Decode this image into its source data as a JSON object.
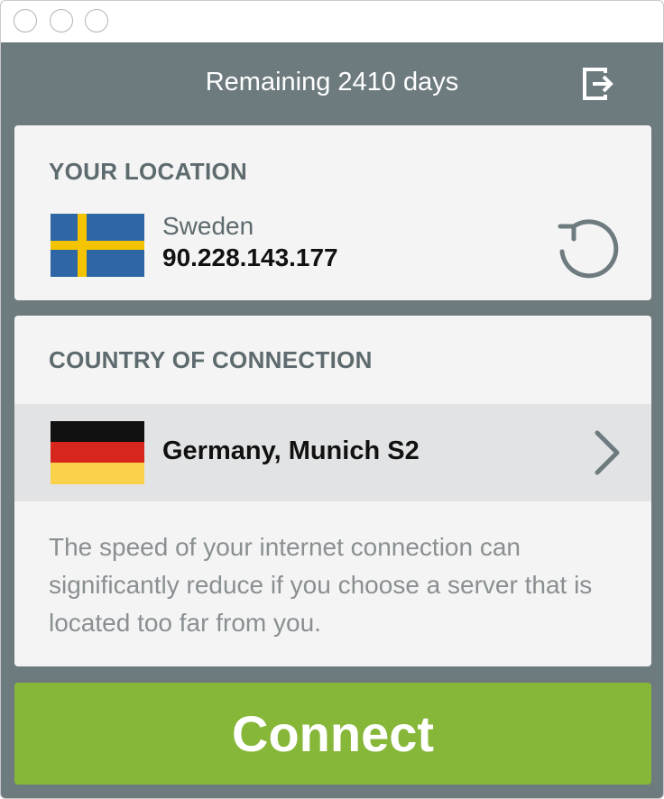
{
  "window": {
    "controls": [
      "close",
      "minimize",
      "zoom"
    ]
  },
  "header": {
    "title": "Remaining 2410 days",
    "logout_icon": "logout-icon"
  },
  "your_location": {
    "heading": "YOUR LOCATION",
    "country": "Sweden",
    "ip": "90.228.143.177",
    "flag_icon": "sweden-flag-icon",
    "refresh_icon": "refresh-icon"
  },
  "connection": {
    "heading": "COUNTRY OF CONNECTION",
    "server": "Germany, Munich S2",
    "flag_icon": "germany-flag-icon",
    "chevron_icon": "chevron-right-icon",
    "note": "The speed of your internet connection can significantly reduce if you choose a server that is located too far from you."
  },
  "actions": {
    "connect_label": "Connect"
  },
  "colors": {
    "header_bg": "#6d7b7f",
    "card_bg": "#f4f4f4",
    "selected_row_bg": "#e2e3e4",
    "heading_text": "#5d6a6e",
    "note_text": "#8a8f92",
    "connect_bg": "#86b739",
    "sweden_blue": "#2f66a5",
    "sweden_yellow": "#f5c400",
    "germany_black": "#111111",
    "germany_red": "#d7261e",
    "germany_gold": "#f9d14a"
  }
}
